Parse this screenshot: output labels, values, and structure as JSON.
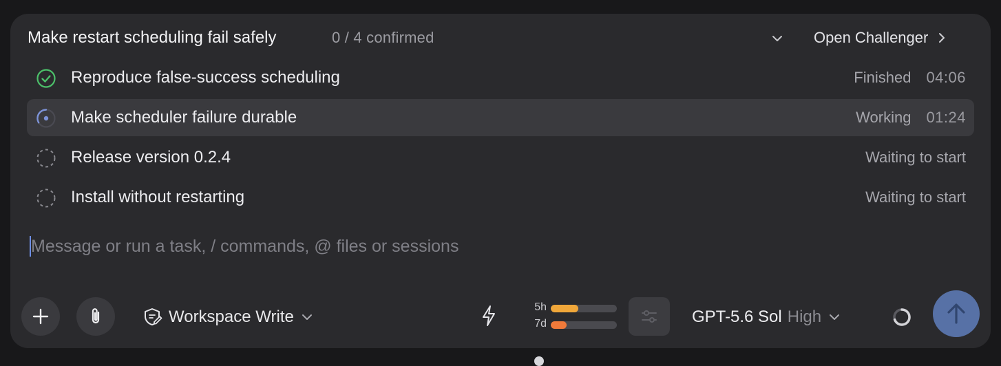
{
  "header": {
    "title": "Make restart scheduling fail safely",
    "counter": "0 / 4 confirmed",
    "open_challenger_label": "Open Challenger"
  },
  "tasks": [
    {
      "label": "Reproduce false-success scheduling",
      "status": "Finished",
      "time": "04:06",
      "state": "done"
    },
    {
      "label": "Make scheduler failure durable",
      "status": "Working",
      "time": "01:24",
      "state": "working"
    },
    {
      "label": "Release version 0.2.4",
      "status": "Waiting to start",
      "time": "",
      "state": "pending"
    },
    {
      "label": "Install without restarting",
      "status": "Waiting to start",
      "time": "",
      "state": "pending"
    }
  ],
  "composer": {
    "placeholder": "Message or run a task, / commands, @ files or sessions",
    "value": ""
  },
  "toolbar": {
    "workspace_label": "Workspace Write",
    "usage": [
      {
        "label": "5h",
        "fraction": 0.42,
        "color": "#f0a73a"
      },
      {
        "label": "7d",
        "fraction": 0.24,
        "color": "#f07a3a"
      }
    ],
    "model_name": "GPT-5.6 Sol",
    "model_effort": "High"
  },
  "icons": {
    "done": "check-circle-icon",
    "working": "progress-ring-icon",
    "pending": "dashed-circle-icon"
  },
  "colors": {
    "accent": "#5771a6",
    "done_green": "#4cc06a",
    "working_blue": "#7d93d8"
  }
}
